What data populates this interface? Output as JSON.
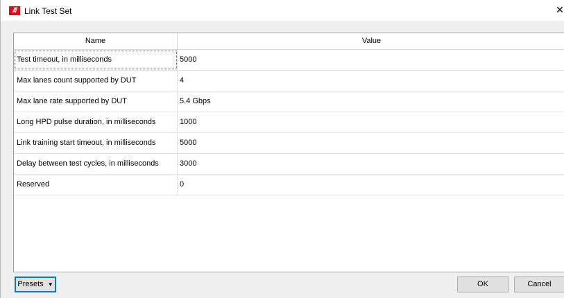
{
  "window": {
    "title": "Link Test Set",
    "logo_text": "///",
    "close_glyph": "✕"
  },
  "grid": {
    "columns": [
      "Name",
      "Value"
    ],
    "rows": [
      {
        "name": "Test timeout, in milliseconds",
        "value": "5000"
      },
      {
        "name": "Max lanes count supported by DUT",
        "value": "4"
      },
      {
        "name": "Max lane rate supported by DUT",
        "value": "5.4 Gbps"
      },
      {
        "name": "Long HPD pulse duration, in milliseconds",
        "value": "1000"
      },
      {
        "name": "Link training start timeout, in milliseconds",
        "value": "5000"
      },
      {
        "name": "Delay between test cycles, in milliseconds",
        "value": "3000"
      },
      {
        "name": "Reserved",
        "value": "0"
      }
    ]
  },
  "footer": {
    "presets_label": "Presets",
    "presets_caret": "▼",
    "ok_label": "OK",
    "cancel_label": "Cancel"
  },
  "colors": {
    "logo": "#d8101a",
    "focus_border": "#0078d7"
  },
  "icons": {
    "app": "app-logo-icon",
    "close": "close-icon",
    "dropdown": "chevron-down-icon"
  }
}
